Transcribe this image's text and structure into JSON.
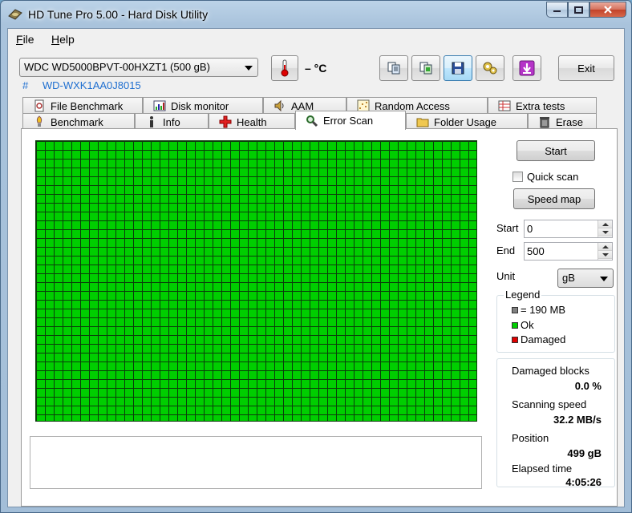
{
  "window": {
    "title": "HD Tune Pro 5.00 - Hard Disk Utility"
  },
  "menu": {
    "items": [
      "File",
      "Help"
    ]
  },
  "drive": {
    "selected": "WDC WD5000BPVT-00HXZT1  (500 gB)",
    "serial_hash": "#",
    "serial": "WD-WXK1AA0J8015"
  },
  "temperature": {
    "value": "– °C"
  },
  "toolbar": {
    "exit_label": "Exit",
    "icons": [
      "copy-info-icon",
      "copy-screenshot-icon",
      "save-icon",
      "options-icon",
      "download-icon"
    ]
  },
  "tabs": {
    "row1": [
      "File Benchmark",
      "Disk monitor",
      "AAM",
      "Random Access",
      "Extra tests"
    ],
    "row2": [
      "Benchmark",
      "Info",
      "Health",
      "Error Scan",
      "Folder Usage",
      "Erase"
    ],
    "active": "Error Scan"
  },
  "scan": {
    "grid_status": "Ok",
    "start_label": "Start",
    "quick_scan_label": "Quick scan",
    "quick_scan_checked": false,
    "speed_map_label": "Speed map",
    "start_field_label": "Start",
    "start_value": "0",
    "end_field_label": "End",
    "end_value": "500",
    "unit_label": "Unit",
    "unit_value": "gB"
  },
  "legend": {
    "title": "Legend",
    "items": [
      {
        "label": "= 190 MB",
        "color": "#808080"
      },
      {
        "label": "Ok",
        "color": "#00ce00"
      },
      {
        "label": "Damaged",
        "color": "#e00000"
      }
    ]
  },
  "stats": {
    "damaged_label": "Damaged blocks",
    "damaged_value": "0.0 %",
    "speed_label": "Scanning speed",
    "speed_value": "32.2 MB/s",
    "position_label": "Position",
    "position_value": "499 gB",
    "elapsed_label": "Elapsed time",
    "elapsed_value": "4:05:26"
  },
  "colors": {
    "ok": "#00ce00",
    "damaged": "#e00000",
    "serial": "#1f6fd0"
  }
}
